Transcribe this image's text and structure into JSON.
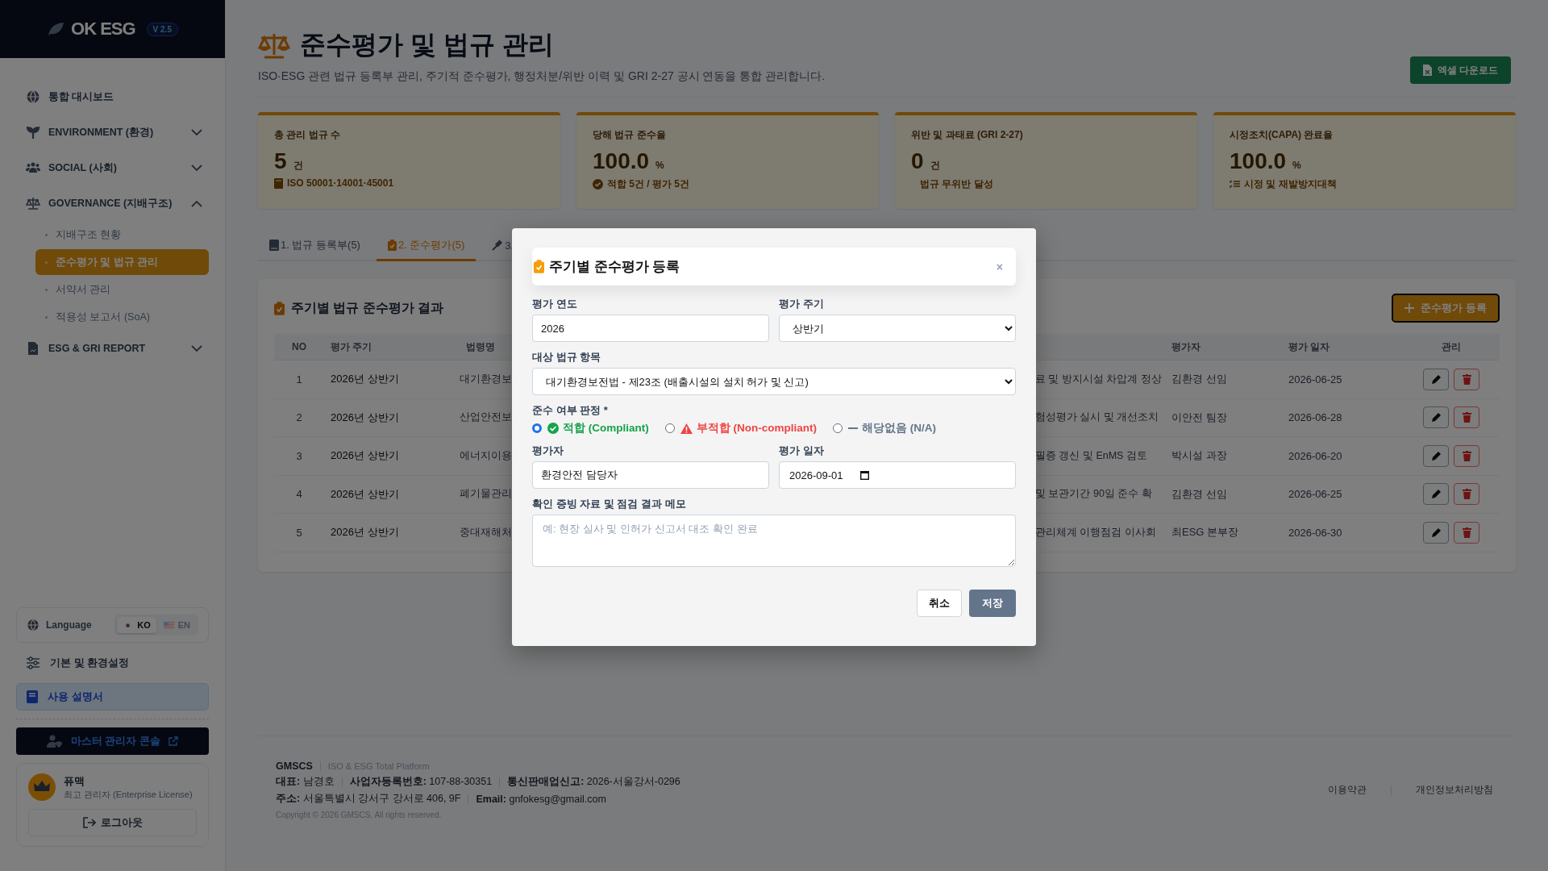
{
  "sidebar": {
    "logo": "OK ESG",
    "version": "V 2.5",
    "nav": [
      {
        "label": "통합 대시보드",
        "kind": "link"
      },
      {
        "label": "ENVIRONMENT (환경)",
        "kind": "group",
        "expanded": false
      },
      {
        "label": "SOCIAL (사회)",
        "kind": "group",
        "expanded": false
      },
      {
        "label": "GOVERNANCE (지배구조)",
        "kind": "group",
        "expanded": true,
        "children": [
          {
            "label": "지배구조 현황",
            "selected": false
          },
          {
            "label": "준수평가 및 법규 관리",
            "selected": true
          },
          {
            "label": "서약서 관리",
            "selected": false
          },
          {
            "label": "적용성 보고서 (SoA)",
            "selected": false
          }
        ]
      },
      {
        "label": "ESG & GRI REPORT",
        "kind": "group",
        "expanded": false
      }
    ],
    "language": {
      "label": "Language",
      "options": [
        {
          "label": "KO",
          "selected": true
        },
        {
          "label": "EN",
          "selected": false
        }
      ]
    },
    "settings_link": "기본 및 환경설정",
    "manual_link": "사용 설명서",
    "admin_console": "마스터 관리자 콘솔",
    "user": {
      "name": "퓨맥",
      "role": "최고 관리자 (Enterprise License)"
    },
    "logout": "로그아웃"
  },
  "header": {
    "title": "준수평가 및 법규 관리",
    "subtitle": "ISO·ESG 관련 법규 등록부 관리, 주기적 준수평가, 행정처분/위반 이력 및 GRI 2-27 공시 연동을 통합 관리합니다.",
    "excel_button": "엑셀 다운로드"
  },
  "stats": [
    {
      "label": "총 관리 법규 수",
      "value": "5",
      "unit": "건",
      "note": "ISO 50001·14001·45001"
    },
    {
      "label": "당해 법규 준수율",
      "value": "100.0",
      "unit": "%",
      "note": "적합 5건 / 평가 5건"
    },
    {
      "label": "위반 및 과태료 (GRI 2-27)",
      "value": "0",
      "unit": "건",
      "note": "법규 무위반 달성"
    },
    {
      "label": "시정조치(CAPA) 완료율",
      "value": "100.0",
      "unit": "%",
      "note": "시정 및 재발방지대책"
    }
  ],
  "tabs": [
    {
      "label": "1. 법규 등록부(5)",
      "selected": false
    },
    {
      "label": "2. 준수평가(5)",
      "selected": true
    },
    {
      "label": "3.",
      "selected": false
    }
  ],
  "section": {
    "title": "주기별 법규 준수평가 결과",
    "add_button": "준수평가 등록"
  },
  "table": {
    "columns": [
      "NO",
      "평가 주기",
      "법령명",
      "평가자",
      "평가 일자",
      "관리"
    ],
    "rows": [
      {
        "no": "1",
        "period": "2026년 상반기",
        "law": "대기환경보",
        "column_4": "료 및 방지시설 차압계 정상",
        "assessor": "김환경 선임",
        "date": "2026-06-25"
      },
      {
        "no": "2",
        "period": "2026년 상반기",
        "law": "산업안전보",
        "column_4": "험성평가 실시 및 개선조치",
        "assessor": "이안전 팀장",
        "date": "2026-06-28"
      },
      {
        "no": "3",
        "period": "2026년 상반기",
        "law": "에너지이용",
        "column_4": "필증 갱신 및 EnMS 검토",
        "assessor": "박시설 과장",
        "date": "2026-06-20"
      },
      {
        "no": "4",
        "period": "2026년 상반기",
        "law": "폐기물관리",
        "column_4": "및 보관기간 90일 준수 확",
        "assessor": "김환경 선임",
        "date": "2026-06-25"
      },
      {
        "no": "5",
        "period": "2026년 상반기",
        "law": "중대재해처",
        "column_4": "관리체계 이행점검 이사회",
        "assessor": "최ESG 본부장",
        "date": "2026-06-30"
      }
    ]
  },
  "footer": {
    "company": "GMSCS",
    "tagline": "ISO & ESG Total Platform",
    "line_1": [
      "**대표:** 남경호",
      "**사업자등록번호:** 107-88-30351",
      "**통신판매업신고:** 2026-서울강서-0296"
    ],
    "line_2": [
      "**주소:** 서울특별시 강서구 강서로 406, 9F",
      "**Email:** gnfokesg@gmail.com"
    ],
    "copyright": "Copyright © 2026 GMSCS. All rights reserved.",
    "links": [
      "이용약관",
      "개인정보처리방침"
    ]
  },
  "modal": {
    "title": "주기별 준수평가 등록",
    "close": "×",
    "year": {
      "label": "평가 연도",
      "value": "2026"
    },
    "period": {
      "label": "평가 주기",
      "value": "상반기"
    },
    "target": {
      "label": "대상 법규 항목",
      "value": "대기환경보전법 - 제23조 (배출시설의 설치 허가 및 신고)"
    },
    "judgment": {
      "label": "준수 여부 판정 *",
      "options": [
        {
          "label": "적합 (Compliant)",
          "kind": "compliant",
          "selected": true
        },
        {
          "label": "부적합 (Non-compliant)",
          "kind": "noncompliant",
          "selected": false
        },
        {
          "label": "해당없음 (N/A)",
          "kind": "na",
          "selected": false
        }
      ]
    },
    "assessor": {
      "label": "평가자",
      "value": "환경안전 담당자"
    },
    "date": {
      "label": "평가 일자",
      "value": "2026-09-01"
    },
    "memo": {
      "label": "확인 증빙 자료 및 점검 결과 메모",
      "placeholder": "예: 현장 실사 및 인허가 신고서 대조 확인 완료"
    },
    "cancel": "취소",
    "save": "저장"
  }
}
